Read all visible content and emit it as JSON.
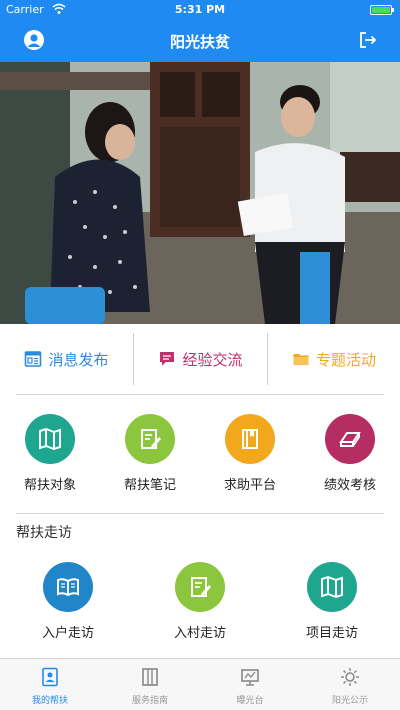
{
  "status_bar": {
    "carrier": "Carrier",
    "time": "5:31 PM"
  },
  "nav": {
    "title": "阳光扶贫",
    "left_icon": "user-icon",
    "right_icon": "logout-icon"
  },
  "quick_actions": [
    {
      "label": "消息发布",
      "icon": "message-icon",
      "color": "#2a8be0"
    },
    {
      "label": "经验交流",
      "icon": "chat-icon",
      "color": "#c0306e"
    },
    {
      "label": "专题活动",
      "icon": "folder-icon",
      "color": "#f2a81d"
    }
  ],
  "grid_main": [
    {
      "label": "帮扶对象",
      "icon": "map-icon",
      "color": "#1fa68f"
    },
    {
      "label": "帮扶笔记",
      "icon": "note-icon",
      "color": "#8cc63f"
    },
    {
      "label": "求助平台",
      "icon": "book-icon",
      "color": "#f2a81d"
    },
    {
      "label": "绩效考核",
      "icon": "exam-book-icon",
      "color": "#b52d62"
    }
  ],
  "section_visit": {
    "title": "帮扶走访",
    "items": [
      {
        "label": "入户走访",
        "icon": "open-book-icon",
        "color": "#2185c9"
      },
      {
        "label": "入村走访",
        "icon": "edit-icon",
        "color": "#8cc63f"
      },
      {
        "label": "项目走访",
        "icon": "map-icon",
        "color": "#1fa68f"
      }
    ]
  },
  "tabs": [
    {
      "label": "我的帮扶",
      "icon": "profile-card-icon",
      "active": true
    },
    {
      "label": "服务指南",
      "icon": "guide-book-icon",
      "active": false
    },
    {
      "label": "曝光台",
      "icon": "screen-icon",
      "active": false
    },
    {
      "label": "阳光公示",
      "icon": "sun-icon",
      "active": false
    }
  ],
  "colors": {
    "primary": "#1f8bf2",
    "tab_active": "#1f8bf2",
    "tab_inactive": "#999999"
  }
}
